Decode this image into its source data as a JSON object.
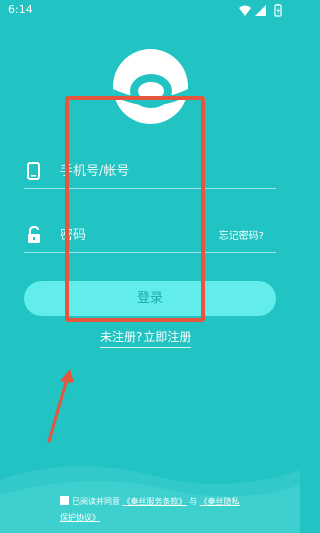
{
  "status_bar": {
    "time": "6:14",
    "icons": [
      "wifi-icon",
      "signal-icon",
      "battery-icon"
    ]
  },
  "login_form": {
    "phone_placeholder": "手机号/帐号",
    "password_placeholder": "密码",
    "forgot_password": "忘记密码?",
    "login_button": "登录",
    "register_prompt": "未注册?",
    "register_action": "立即注册"
  },
  "agreement": {
    "prefix": "已阅读并同意",
    "terms_link": "《秦丝服务条款》",
    "conjunction": "与",
    "privacy_link": "《秦丝隐私保护协议》"
  },
  "colors": {
    "background": "#22c3c3",
    "button": "#62ecec",
    "button_text": "#1ea9a9",
    "annotation": "#e6553e"
  }
}
